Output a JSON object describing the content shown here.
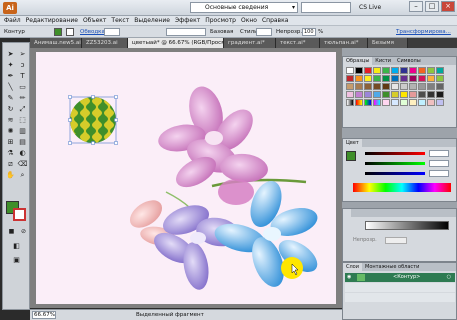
{
  "app": {
    "logo": "Ai",
    "workspace": "Основные сведения",
    "cs_live": "CS Live",
    "win_min": "–",
    "win_max": "□",
    "win_close": "×"
  },
  "menu": [
    "Файл",
    "Редактирование",
    "Объект",
    "Текст",
    "Выделение",
    "Эффект",
    "Просмотр",
    "Окно",
    "Справка"
  ],
  "control": {
    "label": "Контур",
    "stroke_label": "Обводка:",
    "base_label": "Базовая",
    "style_label": "Стиль:",
    "opacity_label": "Непрозр.:",
    "opacity_value": "100",
    "opacity_unit": "%",
    "transform_link": "Трансформирова..."
  },
  "tabs": [
    "Анимаш.new5.ai*",
    "ZZ53203.ai",
    "цветыай* @ 66.67% (RGB/Просмотр)",
    "градиент.ai*",
    "текст.ai*",
    "тюльпан.ai*",
    "Безымя"
  ],
  "status": {
    "zoom": "66.67%",
    "selection": "Выделенный фрагмент"
  },
  "panels": {
    "swatches_tabs": [
      "Образцы",
      "Кисти",
      "Символы"
    ],
    "color_tab": "Цвет",
    "opacity_label": "Непрозр.",
    "layers_tabs": [
      "Слои",
      "Монтажные области"
    ],
    "layer_name": "<Контур>"
  },
  "colors": {
    "accent": "#1a4fb8",
    "canvas_bg": "#fbeef8",
    "highlight_dot": "#ffe600",
    "melon_green": "#3f8f2a",
    "petal_pink": "#d98ccf",
    "petal_blue": "#4fa9e8",
    "petal_purple": "#9a86d8"
  },
  "icons": [
    "selection-arrow-icon",
    "direct-selection-icon",
    "magic-wand-icon",
    "lasso-icon",
    "pen-icon",
    "type-icon",
    "line-icon",
    "rectangle-icon",
    "brush-icon",
    "pencil-icon",
    "rotate-icon",
    "scale-icon",
    "warp-icon",
    "free-transform-icon",
    "symbol-sprayer-icon",
    "graph-icon",
    "mesh-icon",
    "gradient-icon",
    "eyedropper-icon",
    "blend-icon",
    "slice-icon",
    "eraser-icon",
    "hand-icon",
    "zoom-icon"
  ]
}
